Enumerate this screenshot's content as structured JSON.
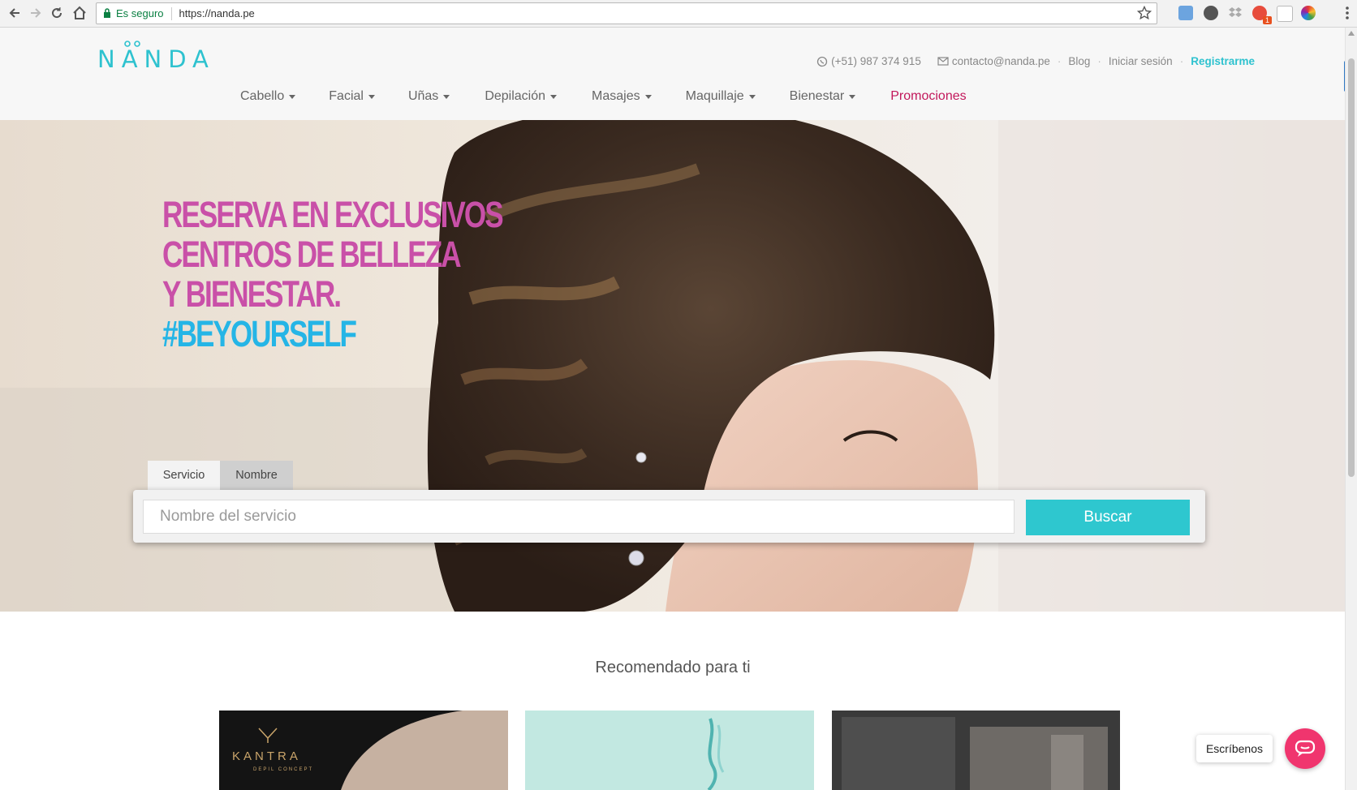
{
  "browser": {
    "secure_label": "Es seguro",
    "url": "https://nanda.pe",
    "extension_badge": "1"
  },
  "site": {
    "logo": "NANDA",
    "phone": "(+51) 987 374 915",
    "email": "contacto@nanda.pe",
    "blog": "Blog",
    "login": "Iniciar sesión",
    "register": "Registrarme",
    "nav": {
      "cabello": "Cabello",
      "facial": "Facial",
      "unas": "Uñas",
      "depilacion": "Depilación",
      "masajes": "Masajes",
      "maquillaje": "Maquillaje",
      "bienestar": "Bienestar",
      "promociones": "Promociones"
    }
  },
  "hero": {
    "line1": "RESERVA EN EXCLUSIVOS",
    "line2": "CENTROS DE BELLEZA",
    "line3": "Y BIENESTAR.",
    "hashtag": "#BEYOURSELF"
  },
  "search": {
    "tab_service": "Servicio",
    "tab_name": "Nombre",
    "placeholder": "Nombre del servicio",
    "button": "Buscar"
  },
  "recommended": {
    "title": "Recomendado para ti",
    "card1_brand": "KANTRA",
    "card1_sub": "DEPIL CONCEPT"
  },
  "chat": {
    "label": "Escríbenos"
  },
  "colors": {
    "accent": "#2ec7cf",
    "promo": "#c2185b",
    "headline_pink": "#c950a8",
    "headline_blue": "#25b5e6",
    "chat": "#f0356e"
  }
}
